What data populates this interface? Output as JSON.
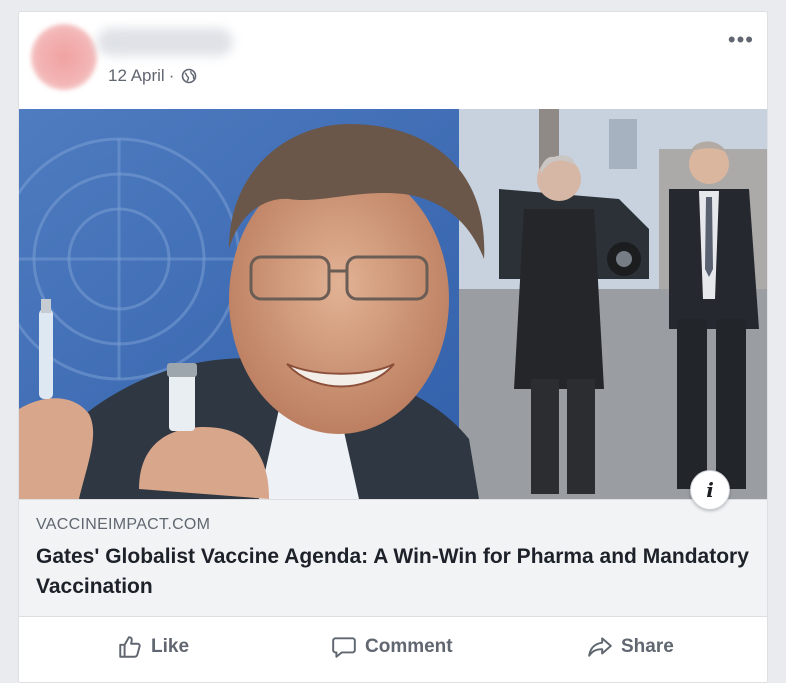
{
  "post": {
    "date": "12 April",
    "separator": "·",
    "privacy_icon": "globe-icon",
    "more_icon": "more-options-icon",
    "more_label": "•••"
  },
  "link": {
    "domain": "VACCINEIMPACT.COM",
    "headline": "Gates' Globalist Vaccine Agenda: A Win-Win for Pharma and Mandatory Vaccination",
    "info_label": "i"
  },
  "actions": {
    "like": "Like",
    "comment": "Comment",
    "share": "Share"
  },
  "colors": {
    "background": "#e9ebee",
    "text_secondary": "#606770",
    "headline": "#1d2129",
    "link_box": "#f2f3f5"
  }
}
